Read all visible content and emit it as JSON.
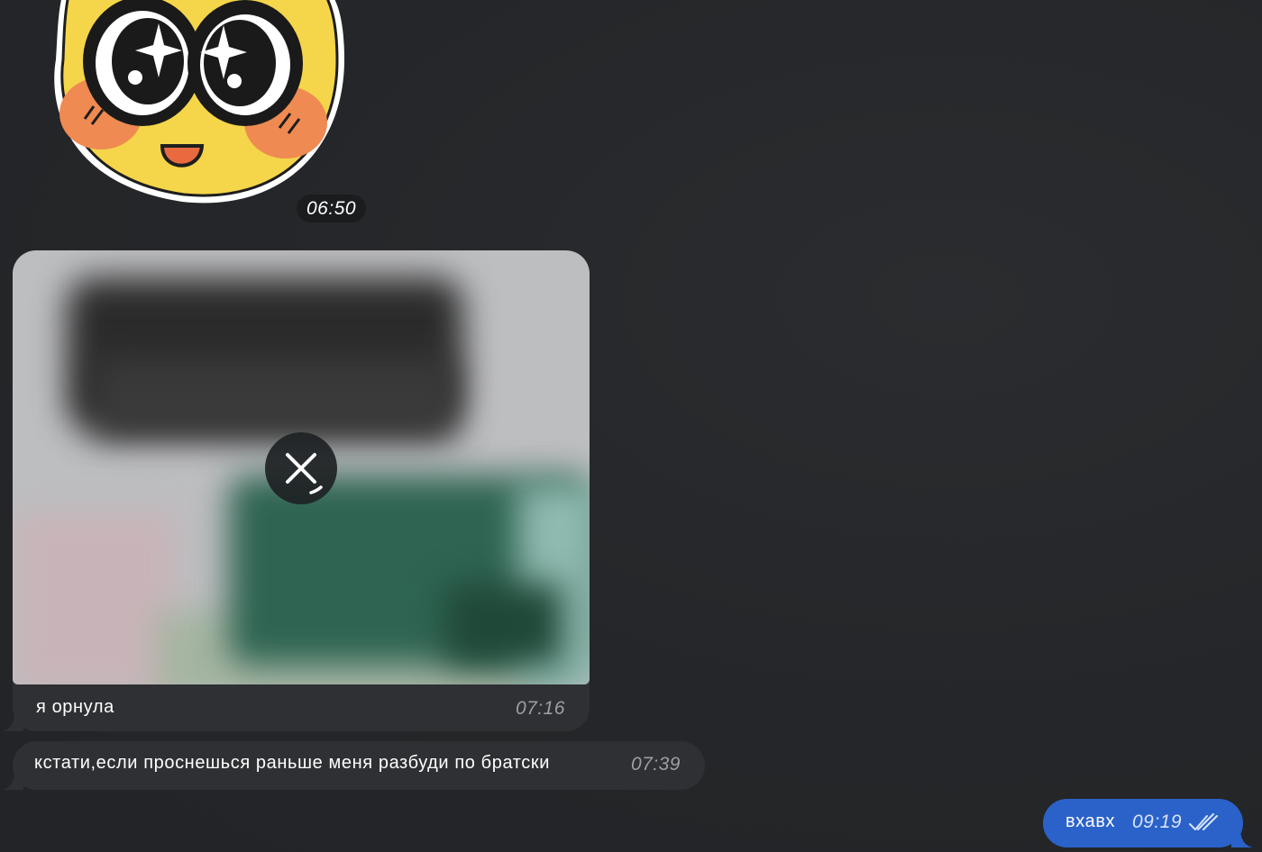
{
  "messages": {
    "sticker": {
      "icon": "sticker-face-icon",
      "time": "06:50"
    },
    "photo": {
      "caption": "я орнула",
      "time": "07:16",
      "cancel_icon": "close-icon"
    },
    "text_in": {
      "text": "кстати,если проснешься раньше меня разбуди по братски",
      "time": "07:39"
    },
    "text_out": {
      "text": "вхавх",
      "time": "09:19",
      "status_icon": "double-check-icon"
    }
  },
  "colors": {
    "background": "#25272a",
    "incoming_bubble": "#2e3033",
    "outgoing_bubble": "#2a62c9",
    "timestamp": "#9c9ea2"
  }
}
